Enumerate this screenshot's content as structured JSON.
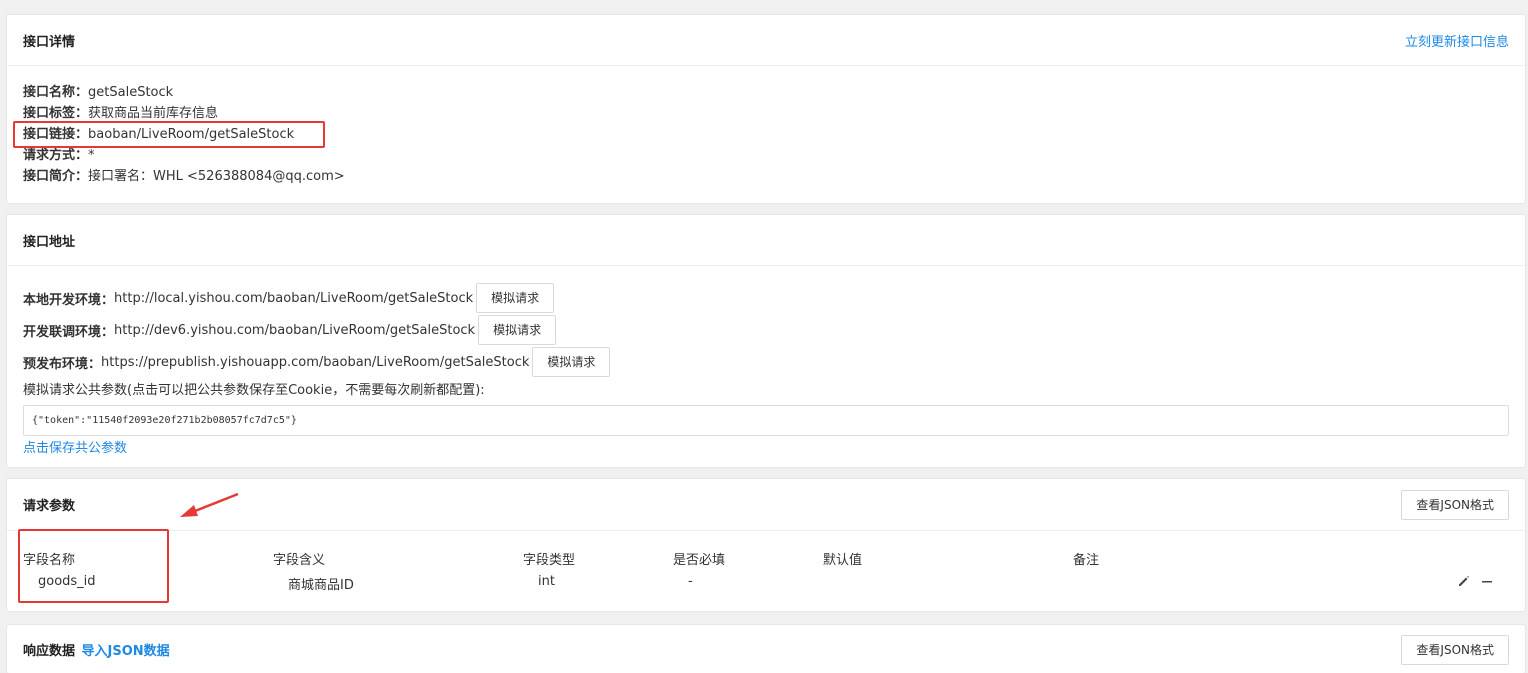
{
  "detail": {
    "title": "接口详情",
    "refresh_link": "立刻更新接口信息",
    "rows": [
      {
        "label": "接口名称：",
        "value": "getSaleStock"
      },
      {
        "label": "接口标签：",
        "value": "获取商品当前库存信息"
      },
      {
        "label": "接口链接：",
        "value": "baoban/LiveRoom/getSaleStock"
      },
      {
        "label": "请求方式：",
        "value": "*"
      },
      {
        "label": "接口简介：",
        "value": "接口署名：WHL <526388084@qq.com>"
      }
    ]
  },
  "address": {
    "title": "接口地址",
    "envs": [
      {
        "label": "本地开发环境：",
        "url": "http://local.yishou.com/baoban/LiveRoom/getSaleStock",
        "button": "模拟请求"
      },
      {
        "label": "开发联调环境：",
        "url": "http://dev6.yishou.com/baoban/LiveRoom/getSaleStock",
        "button": "模拟请求"
      },
      {
        "label": "预发布环境：",
        "url": "https://prepublish.yishouapp.com/baoban/LiveRoom/getSaleStock",
        "button": "模拟请求"
      }
    ],
    "params_hint": "模拟请求公共参数(点击可以把公共参数保存至Cookie，不需要每次刷新都配置):",
    "params_value": "{\"token\":\"11540f2093e20f271b2b08057fc7d7c5\"}",
    "save_link": "点击保存共公参数"
  },
  "request": {
    "title": "请求参数",
    "json_button": "查看JSON格式",
    "columns": [
      "字段名称",
      "字段含义",
      "字段类型",
      "是否必填",
      "默认值",
      "备注"
    ],
    "rows": [
      {
        "name": "goods_id",
        "meaning": "商城商品ID",
        "type": "int",
        "required": "-",
        "default": "",
        "note": ""
      }
    ]
  },
  "response": {
    "title": "响应数据",
    "import_link": "导入JSON数据",
    "json_button": "查看JSON格式"
  },
  "colors": {
    "link": "#1e88e5",
    "highlight": "#e53935"
  }
}
